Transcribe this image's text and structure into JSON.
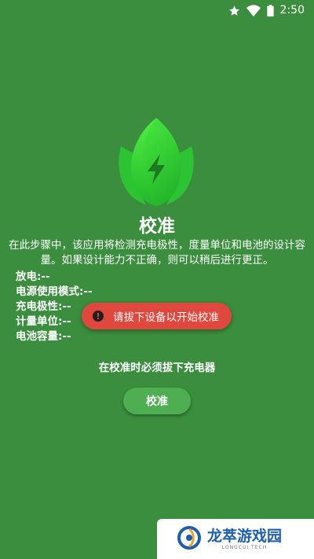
{
  "status_bar": {
    "time": "2:50",
    "icons": [
      "star-icon",
      "wifi-icon",
      "battery-icon"
    ]
  },
  "calibration": {
    "title": "校准",
    "description": "在此步骤中，该应用将检测充电极性，度量单位和电池的设计容量。如果设计能力不正确，则可以稍后进行更正。",
    "info_rows": [
      {
        "label": "放电:",
        "value": "--"
      },
      {
        "label": "电源使用模式:",
        "value": "--"
      },
      {
        "label": "充电极性:",
        "value": "--"
      },
      {
        "label": "计量单位:",
        "value": "--"
      },
      {
        "label": "电池容量:",
        "value": "--"
      }
    ],
    "hint": "在校准时必须拔下充电器",
    "button_label": "校准"
  },
  "toast": {
    "icon": "error-icon",
    "message": "请拔下设备以开始校准"
  },
  "watermark": {
    "name": "龙萃游戏园",
    "subtitle": "LONGCUI.TECH"
  },
  "colors": {
    "background": "#3a8e3e",
    "button": "#4fae52",
    "toast": "#e0483e",
    "logo_green": "#3ddc3a"
  }
}
